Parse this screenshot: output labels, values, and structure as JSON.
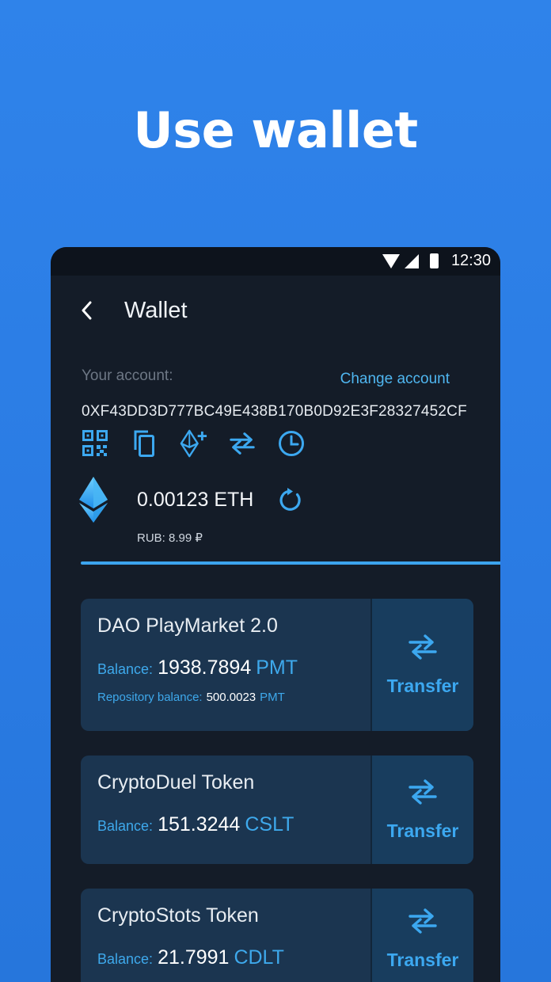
{
  "headline": "Use wallet",
  "status_bar": {
    "time": "12:30"
  },
  "app_bar": {
    "title": "Wallet"
  },
  "account": {
    "label": "Your account:",
    "change_label": "Change account",
    "address": "0XF43DD3D777BC49E438B170B0D92E3F28327452CF"
  },
  "actions": [
    "qr-code-icon",
    "copy-icon",
    "add-token-icon",
    "swap-icon",
    "history-icon"
  ],
  "balance": {
    "amount": "0.00123 ETH",
    "fiat": "RUB: 8.99 ₽"
  },
  "tokens": [
    {
      "name": "DAO PlayMarket 2.0",
      "balance_label": "Balance:",
      "balance_value": "1938.7894",
      "unit": "PMT",
      "repo_label": "Repository balance:",
      "repo_value": "500.0023",
      "repo_unit": "PMT",
      "action_label": "Transfer"
    },
    {
      "name": "CryptoDuel Token",
      "balance_label": "Balance:",
      "balance_value": "151.3244",
      "unit": "CSLT",
      "action_label": "Transfer"
    },
    {
      "name": "CryptoStots Token",
      "balance_label": "Balance:",
      "balance_value": "21.7991",
      "unit": "CDLT",
      "action_label": "Transfer"
    }
  ],
  "colors": {
    "background": "#2f83ea",
    "phone": "#141c28",
    "accent": "#3ca8f0",
    "card": "#1b3550"
  }
}
